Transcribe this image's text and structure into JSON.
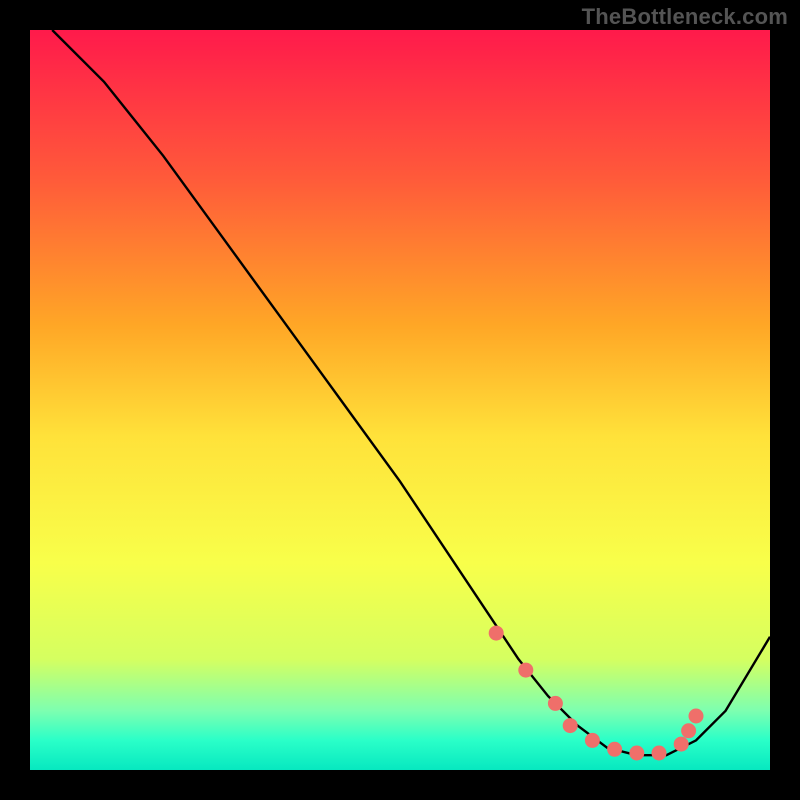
{
  "watermark": "TheBottleneck.com",
  "chart_data": {
    "type": "line",
    "title": "",
    "xlabel": "",
    "ylabel": "",
    "xlim": [
      0,
      100
    ],
    "ylim": [
      0,
      100
    ],
    "grid": false,
    "series": [
      {
        "name": "curve",
        "x": [
          3,
          10,
          18,
          26,
          34,
          42,
          50,
          58,
          62,
          66,
          70,
          74,
          78,
          82,
          86,
          90,
          94,
          100
        ],
        "y": [
          100,
          93,
          83,
          72,
          61,
          50,
          39,
          27,
          21,
          15,
          10,
          6,
          3,
          2,
          2,
          4,
          8,
          18
        ]
      }
    ],
    "markers": {
      "name": "highlight-dots",
      "color": "#ef6f6a",
      "x": [
        63,
        67,
        71,
        73,
        76,
        79,
        82,
        85,
        88,
        89,
        90
      ],
      "y": [
        18.5,
        13.5,
        9,
        6,
        4,
        2.8,
        2.3,
        2.3,
        3.5,
        5.3,
        7.3
      ]
    },
    "gradient_stops": [
      {
        "offset": 0.0,
        "color": "#ff1a4b"
      },
      {
        "offset": 0.2,
        "color": "#ff5a3a"
      },
      {
        "offset": 0.4,
        "color": "#ffa726"
      },
      {
        "offset": 0.55,
        "color": "#ffe23a"
      },
      {
        "offset": 0.72,
        "color": "#f8ff4a"
      },
      {
        "offset": 0.85,
        "color": "#d5ff60"
      },
      {
        "offset": 0.92,
        "color": "#7dffb0"
      },
      {
        "offset": 0.96,
        "color": "#2affc8"
      },
      {
        "offset": 1.0,
        "color": "#07e8c0"
      }
    ]
  }
}
